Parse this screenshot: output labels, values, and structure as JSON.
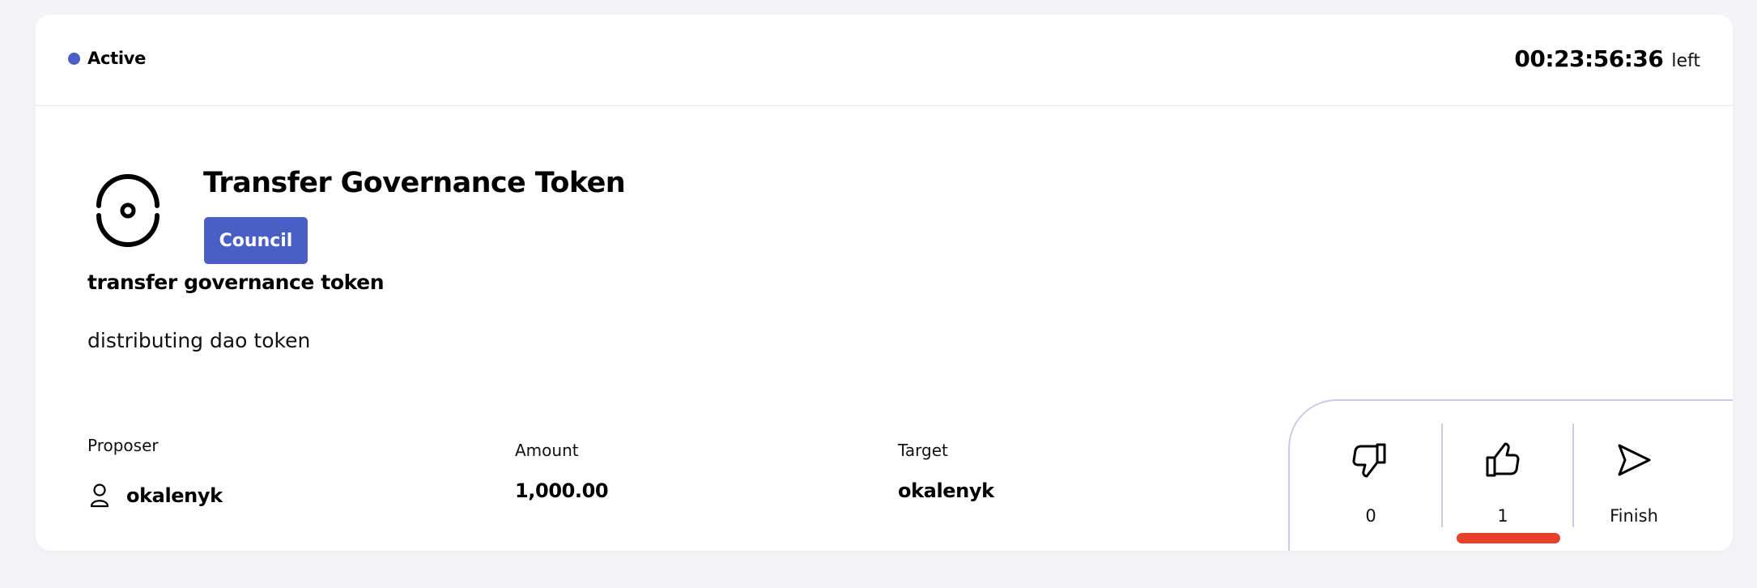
{
  "status": {
    "label": "Active",
    "dot_color": "#4a5fc6"
  },
  "timer": {
    "value": "00:23:56:36",
    "suffix": "left"
  },
  "proposal": {
    "icon": "proposal-target-icon",
    "title": "Transfer Governance Token",
    "badge": "Council",
    "subtitle": "transfer governance token",
    "description": "distributing dao token"
  },
  "details": {
    "proposer": {
      "label": "Proposer",
      "value": "okalenyk",
      "icon": "user-icon"
    },
    "amount": {
      "label": "Amount",
      "value": "1,000.00"
    },
    "target": {
      "label": "Target",
      "value": "okalenyk"
    }
  },
  "votes": {
    "dislike": {
      "icon": "thumbs-down-icon",
      "count": "0"
    },
    "like": {
      "icon": "thumbs-up-icon",
      "count": "1"
    },
    "finish": {
      "icon": "send-icon",
      "label": "Finish"
    }
  },
  "colors": {
    "accent": "#4a5fc6",
    "highlight": "#e8402c",
    "panel_border": "#c9cbe8"
  }
}
